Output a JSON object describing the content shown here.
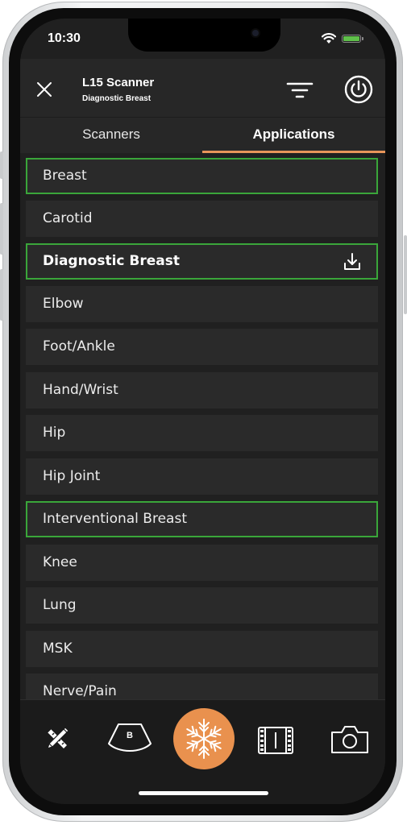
{
  "status_bar": {
    "time": "10:30"
  },
  "header": {
    "title": "L15 Scanner",
    "subtitle": "Diagnostic Breast"
  },
  "tabs": [
    {
      "label": "Scanners",
      "active": false
    },
    {
      "label": "Applications",
      "active": true
    }
  ],
  "applications": [
    {
      "label": "Breast",
      "selected": true,
      "current": false,
      "download": false
    },
    {
      "label": "Carotid",
      "selected": false,
      "current": false,
      "download": false
    },
    {
      "label": "Diagnostic Breast",
      "selected": true,
      "current": true,
      "download": true
    },
    {
      "label": "Elbow",
      "selected": false,
      "current": false,
      "download": false
    },
    {
      "label": "Foot/Ankle",
      "selected": false,
      "current": false,
      "download": false
    },
    {
      "label": "Hand/Wrist",
      "selected": false,
      "current": false,
      "download": false
    },
    {
      "label": "Hip",
      "selected": false,
      "current": false,
      "download": false
    },
    {
      "label": "Hip Joint",
      "selected": false,
      "current": false,
      "download": false
    },
    {
      "label": "Interventional Breast",
      "selected": true,
      "current": false,
      "download": false
    },
    {
      "label": "Knee",
      "selected": false,
      "current": false,
      "download": false
    },
    {
      "label": "Lung",
      "selected": false,
      "current": false,
      "download": false
    },
    {
      "label": "MSK",
      "selected": false,
      "current": false,
      "download": false
    },
    {
      "label": "Nerve/Pain",
      "selected": false,
      "current": false,
      "download": false
    }
  ],
  "toolbar": {
    "mode_label": "B",
    "icons": [
      "measure-tools-icon",
      "b-mode-probe-icon",
      "snowflake-freeze-icon",
      "film-cine-icon",
      "camera-icon"
    ]
  },
  "colors": {
    "accent": "#e9914e",
    "selected_border": "#3aa63a",
    "battery": "#5fc04a",
    "background": "#202020"
  }
}
